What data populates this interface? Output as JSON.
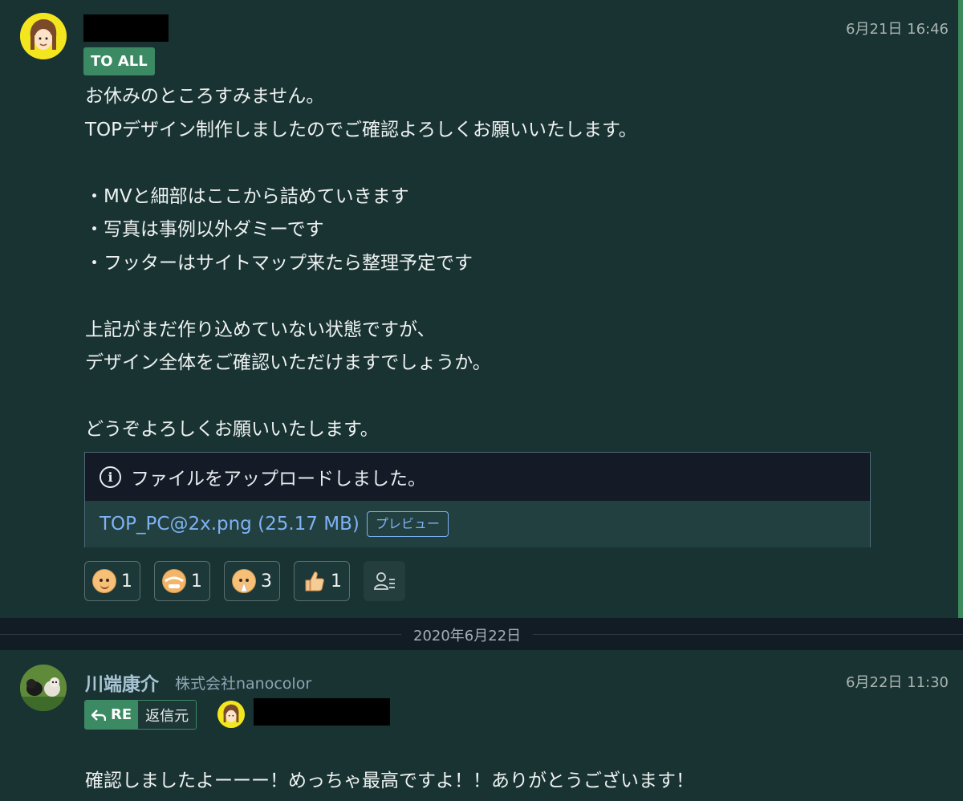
{
  "message1": {
    "timestamp": "6月21日 16:46",
    "badge": "TO ALL",
    "body": "お休みのところすみません。\nTOPデザイン制作しましたのでご確認よろしくお願いいたします。\n\n・MVと細部はここから詰めていきます\n・写真は事例以外ダミーです\n・フッターはサイトマップ来たら整理予定です\n\n上記がまだ作り込めていない状態ですが、\nデザイン全体をご確認いただけますでしょうか。\n\nどうぞよろしくお願いいたします。",
    "file": {
      "header": "ファイルをアップロードしました。",
      "name": "TOP_PC@2x.png (25.17 MB)",
      "preview_label": "プレビュー"
    },
    "reactions": [
      {
        "icon": "smile-face-icon",
        "count": "1"
      },
      {
        "icon": "bow-face-icon",
        "count": "1"
      },
      {
        "icon": "grateful-face-icon",
        "count": "3"
      },
      {
        "icon": "thumbs-up-icon",
        "count": "1"
      }
    ]
  },
  "date_divider": "2020年6月22日",
  "message2": {
    "sender": "川端康介",
    "company": "株式会社nanocolor",
    "timestamp": "6月22日 11:30",
    "re_label": "RE",
    "source_label": "返信元",
    "body": "確認しましたよーーー！めっちゃ最高ですよ！！ありがとうございます！"
  },
  "colors": {
    "background": "#193333",
    "accent_green": "#3b8a63",
    "link_blue": "#7fb2f4"
  }
}
